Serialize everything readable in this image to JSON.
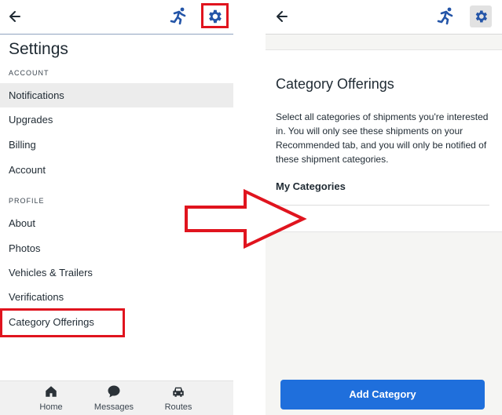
{
  "left_screen": {
    "title": "Settings",
    "sections": {
      "account": {
        "label": "ACCOUNT",
        "items": [
          "Notifications",
          "Upgrades",
          "Billing",
          "Account"
        ]
      },
      "profile": {
        "label": "PROFILE",
        "items": [
          "About",
          "Photos",
          "Vehicles & Trailers",
          "Verifications",
          "Category Offerings"
        ]
      }
    },
    "active_item": "Notifications",
    "bottom_nav": [
      {
        "label": "Home",
        "icon": "home-icon"
      },
      {
        "label": "Messages",
        "icon": "message-bubble-icon"
      },
      {
        "label": "Routes",
        "icon": "car-icon"
      }
    ]
  },
  "right_screen": {
    "card_title": "Category Offerings",
    "description": "Select all categories of shipments you're interested in. You will only see these shipments on your Recommended tab, and you will only be notified of these shipment categories.",
    "subheading": "My Categories",
    "add_button_label": "Add Category"
  },
  "colors": {
    "accent_blue": "#1f6fdc",
    "icon_blue": "#2455a8",
    "highlight_red": "#e0141e",
    "active_row_bg": "#ececec"
  }
}
